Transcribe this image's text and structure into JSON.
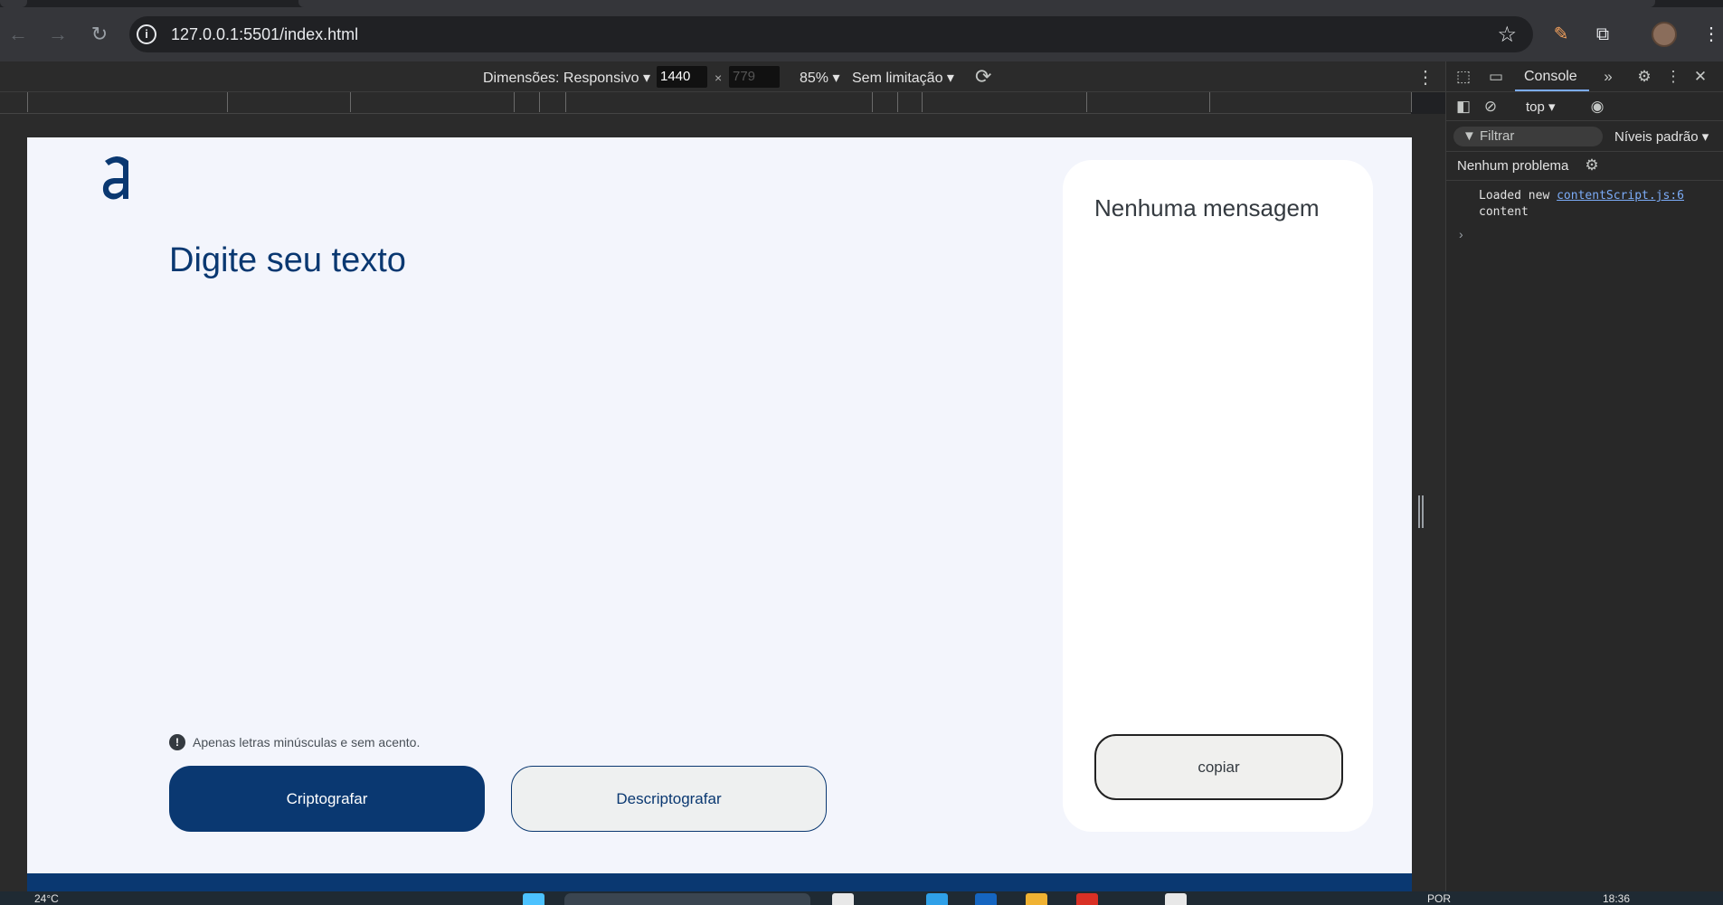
{
  "browser": {
    "url": "127.0.0.1:5501/index.html"
  },
  "device_toolbar": {
    "dimensions_label": "Dimensões: Responsivo",
    "width_value": "1440",
    "times": "×",
    "height_placeholder": "779",
    "zoom": "85%",
    "throttle": "Sem limitação"
  },
  "page": {
    "title": "Digite seu texto",
    "warning": "Apenas letras minúsculas e sem acento.",
    "encrypt_label": "Criptografar",
    "decrypt_label": "Descriptografar",
    "output_heading": "Nenhuma mensagem",
    "copy_label": "copiar",
    "brand_color": "#0a3871"
  },
  "devtools": {
    "tab_console": "Console",
    "context": "top",
    "filter_placeholder": "Filtrar",
    "levels": "Níveis padrão",
    "issues": "Nenhum problema",
    "log_text": "Loaded new",
    "log_link": "contentScript.js:6",
    "log_text2": "content"
  },
  "taskbar": {
    "weather": "24°C",
    "lang": "POR",
    "time": "18:36"
  }
}
